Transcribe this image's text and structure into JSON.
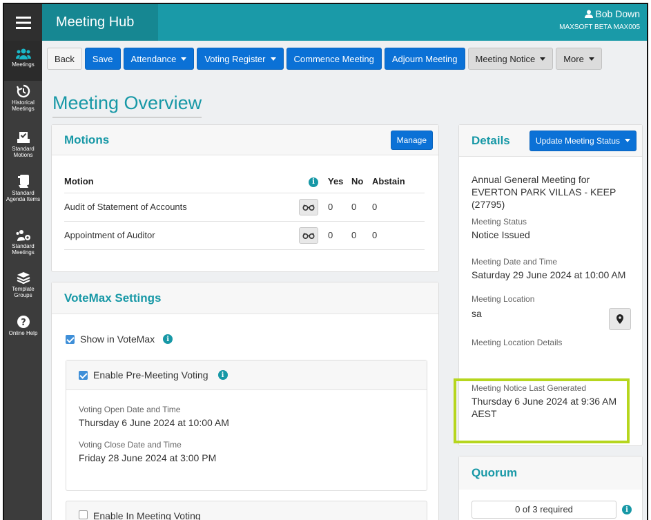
{
  "app": {
    "brand": "Meeting Hub",
    "user_name": "Bob Down",
    "user_org": "MAXSOFT BETA MAX005"
  },
  "sidebar": {
    "items": [
      {
        "label": "Meetings",
        "icon": "users-icon"
      },
      {
        "label": "Historical Meetings",
        "icon": "history-icon"
      },
      {
        "label": "Standard Motions",
        "icon": "ballot-icon"
      },
      {
        "label": "Standard Agenda Items",
        "icon": "agenda-icon"
      },
      {
        "label": "Standard Meetings",
        "icon": "users-gear-icon"
      },
      {
        "label": "Template Groups",
        "icon": "layers-icon"
      },
      {
        "label": "Online Help",
        "icon": "question-icon"
      }
    ]
  },
  "toolbar": {
    "back": "Back",
    "save": "Save",
    "attendance": "Attendance",
    "voting_register": "Voting Register",
    "commence": "Commence Meeting",
    "adjourn": "Adjourn Meeting",
    "meeting_notice": "Meeting Notice",
    "more": "More"
  },
  "page": {
    "title": "Meeting Overview"
  },
  "motions": {
    "title": "Motions",
    "manage": "Manage",
    "headers": {
      "motion": "Motion",
      "yes": "Yes",
      "no": "No",
      "abstain": "Abstain"
    },
    "rows": [
      {
        "name": "Audit of Statement of Accounts",
        "yes": "0",
        "no": "0",
        "abstain": "0"
      },
      {
        "name": "Appointment of Auditor",
        "yes": "0",
        "no": "0",
        "abstain": "0"
      }
    ]
  },
  "votemax": {
    "title": "VoteMax Settings",
    "show_label": "Show in VoteMax",
    "pre_voting_label": "Enable Pre-Meeting Voting",
    "open_label": "Voting Open Date and Time",
    "open_value": "Thursday 6 June 2024 at 10:00 AM",
    "close_label": "Voting Close Date and Time",
    "close_value": "Friday 28 June 2024 at 3:00 PM",
    "in_meeting_label": "Enable In Meeting Voting"
  },
  "details": {
    "title": "Details",
    "update_status": "Update Meeting Status",
    "meeting_name": "Annual General Meeting for EVERTON PARK VILLAS - KEEP (27795)",
    "status_label": "Meeting Status",
    "status_value": "Notice Issued",
    "datetime_label": "Meeting Date and Time",
    "datetime_value": "Saturday 29 June 2024 at 10:00 AM",
    "location_label": "Meeting Location",
    "location_value": "sa",
    "location_details_label": "Meeting Location Details",
    "notice_label": "Meeting Notice Last Generated",
    "notice_value": "Thursday 6 June 2024 at 9:36 AM AEST"
  },
  "quorum": {
    "title": "Quorum",
    "value": "0 of 3 required"
  },
  "colors": {
    "teal": "#1798a6",
    "blue": "#0b71d6",
    "highlight": "#b6d61e"
  }
}
